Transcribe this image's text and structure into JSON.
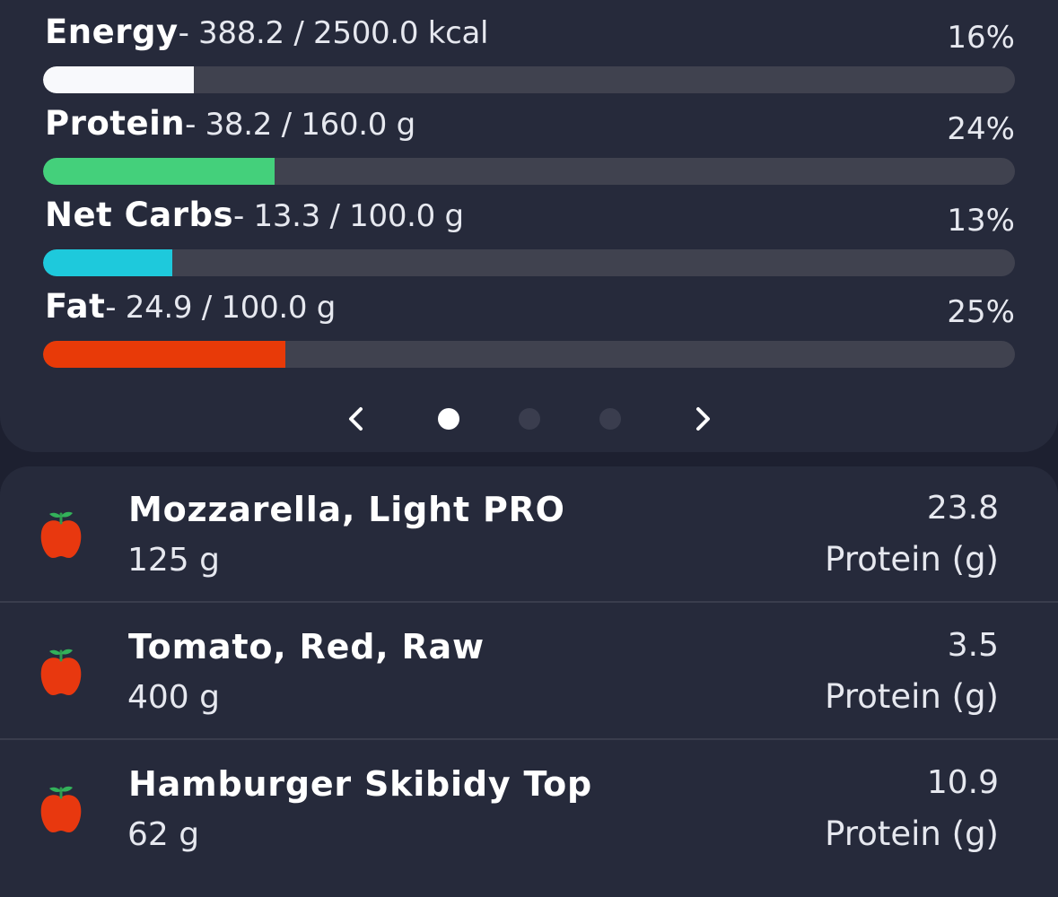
{
  "colors": {
    "background": "#1d2030",
    "card": "#262a3b",
    "track": "#40424f",
    "energy": "#f8f9fc",
    "protein": "#44d07b",
    "net_carbs": "#1ec9dc",
    "fat": "#e83a08",
    "dot_active": "#ffffff",
    "dot_inactive": "#3a3d4e",
    "apple": "#e8380f",
    "apple_leaf": "#33b15a"
  },
  "nutrients": [
    {
      "name": "Energy",
      "amount": "- 388.2 / 2500.0 kcal",
      "percent": "16%",
      "fraction": 0.155,
      "color": "#f8f9fc"
    },
    {
      "name": "Protein",
      "amount": "- 38.2 / 160.0 g",
      "percent": "24%",
      "fraction": 0.238,
      "color": "#44d07b"
    },
    {
      "name": "Net Carbs",
      "amount": "- 13.3 / 100.0 g",
      "percent": "13%",
      "fraction": 0.133,
      "color": "#1ec9dc"
    },
    {
      "name": "Fat",
      "amount": "- 24.9 / 100.0 g",
      "percent": "25%",
      "fraction": 0.249,
      "color": "#e83a08"
    }
  ],
  "pager": {
    "prev_icon": "chevron-left-icon",
    "next_icon": "chevron-right-icon",
    "page_count": 3,
    "active_page": 1
  },
  "foods": [
    {
      "name": "Mozzarella, Light PRO",
      "amount": "125 g",
      "value": "23.8",
      "unit": "Protein (g)",
      "icon": "apple-icon"
    },
    {
      "name": "Tomato, Red, Raw",
      "amount": "400 g",
      "value": "3.5",
      "unit": "Protein (g)",
      "icon": "apple-icon"
    },
    {
      "name": "Hamburger Skibidy Top",
      "amount": "62 g",
      "value": "10.9",
      "unit": "Protein (g)",
      "icon": "apple-icon"
    }
  ]
}
